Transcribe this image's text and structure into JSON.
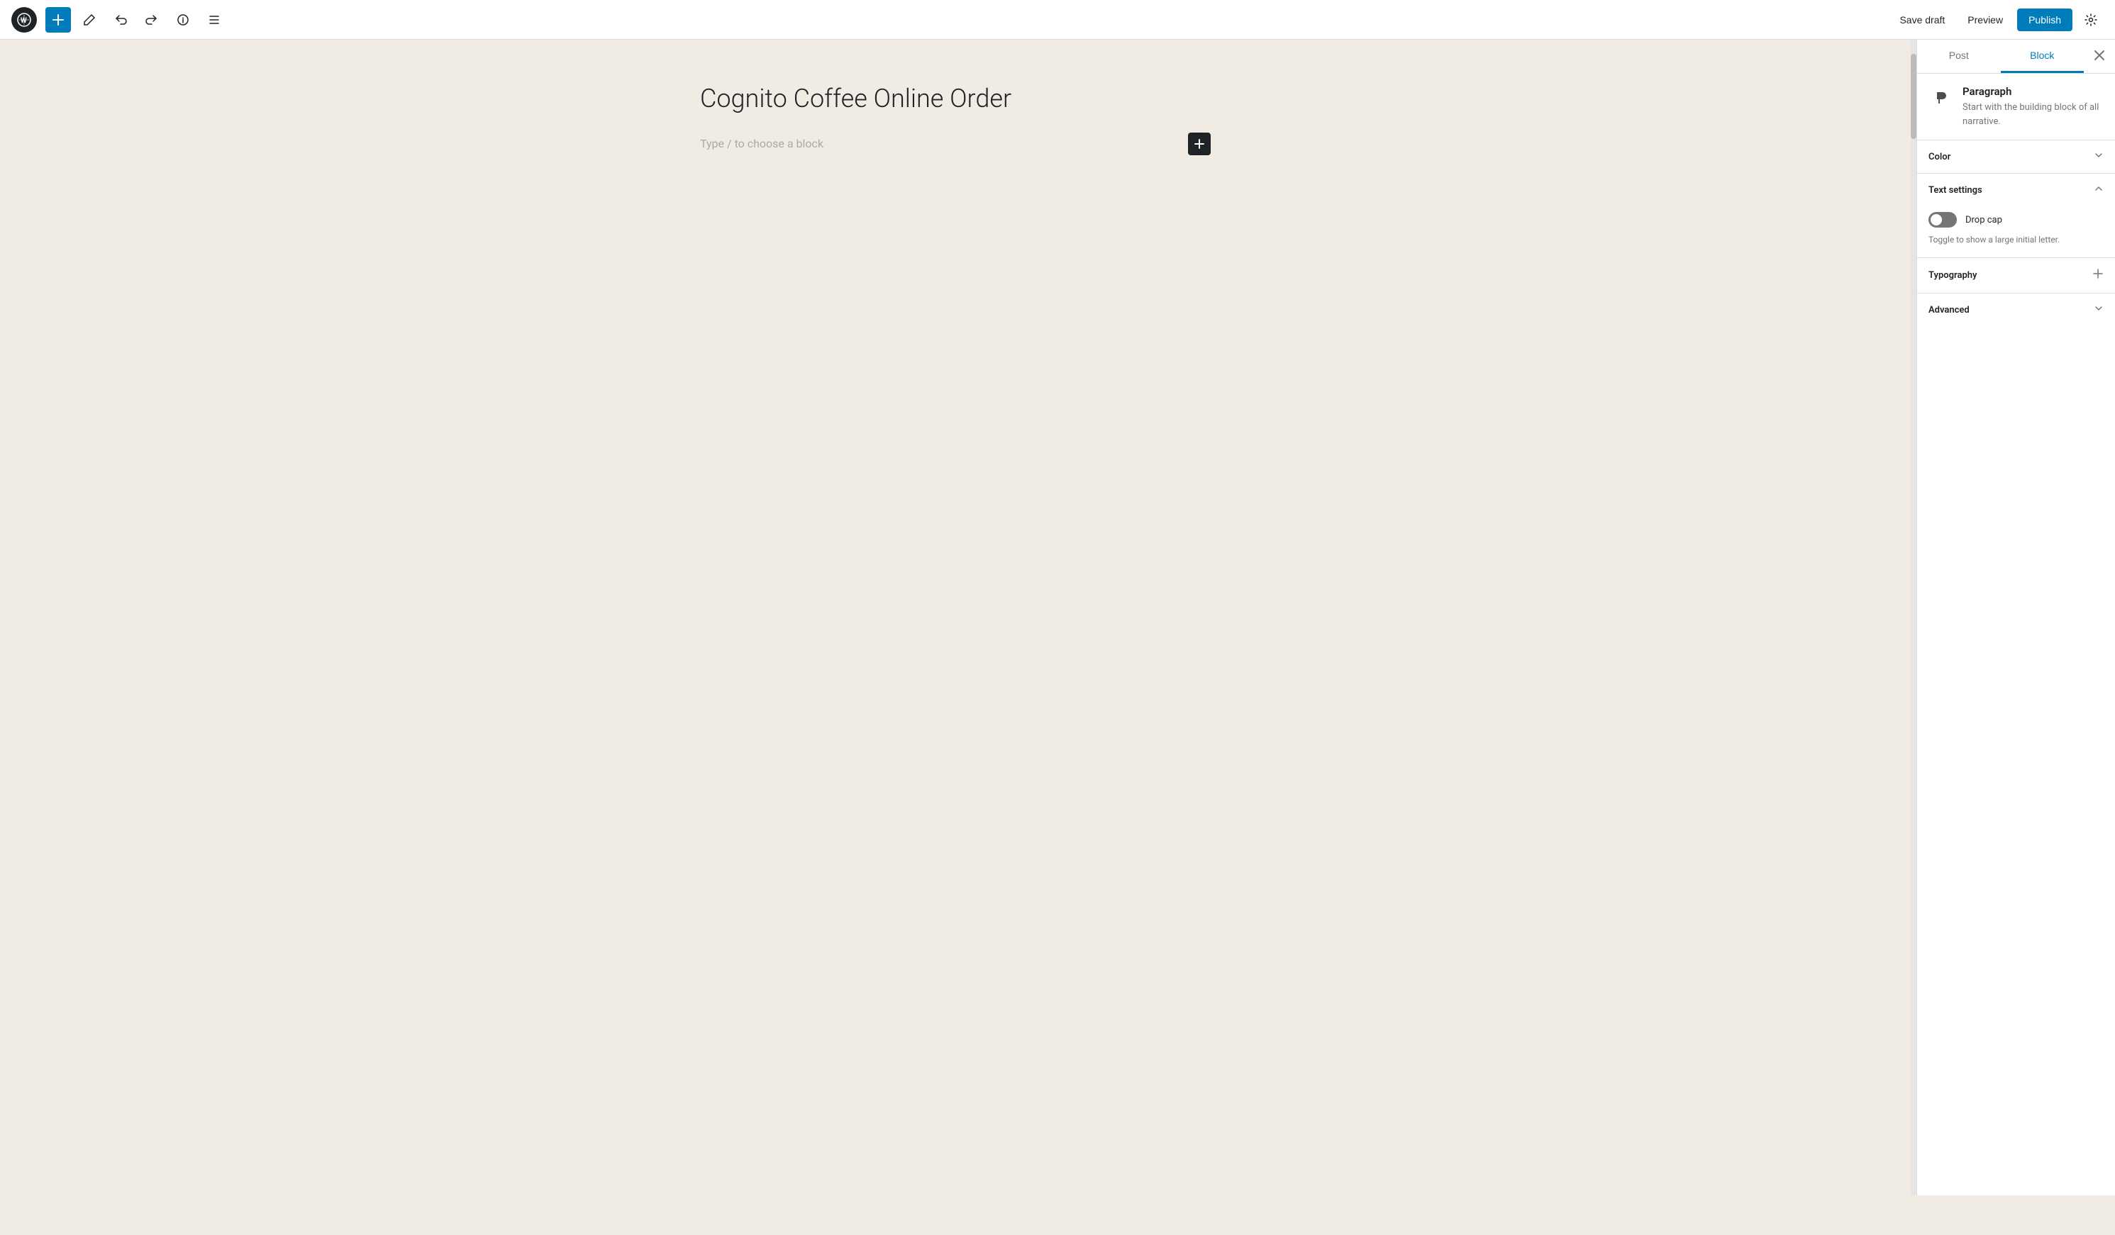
{
  "toolbar": {
    "wp_logo": "W",
    "add_label": "+",
    "pencil_label": "✎",
    "undo_label": "↩",
    "redo_label": "↪",
    "info_label": "ℹ",
    "list_label": "≡",
    "save_draft": "Save draft",
    "preview": "Preview",
    "publish": "Publish",
    "settings_icon": "⚙"
  },
  "sidebar": {
    "tab_post": "Post",
    "tab_block": "Block",
    "close_icon": "✕",
    "block": {
      "icon": "¶",
      "title": "Paragraph",
      "description": "Start with the building block of all narrative."
    },
    "color_section": {
      "title": "Color",
      "collapsed": true
    },
    "text_settings_section": {
      "title": "Text settings",
      "collapsed": false,
      "drop_cap_label": "Drop cap",
      "drop_cap_desc": "Toggle to show a large initial letter.",
      "drop_cap_active": false
    },
    "typography_section": {
      "title": "Typography",
      "has_plus": true
    },
    "advanced_section": {
      "title": "Advanced",
      "collapsed": true
    }
  },
  "editor": {
    "post_title": "Cognito Coffee Online Order",
    "placeholder": "Type / to choose a block",
    "add_block_btn": "+"
  }
}
